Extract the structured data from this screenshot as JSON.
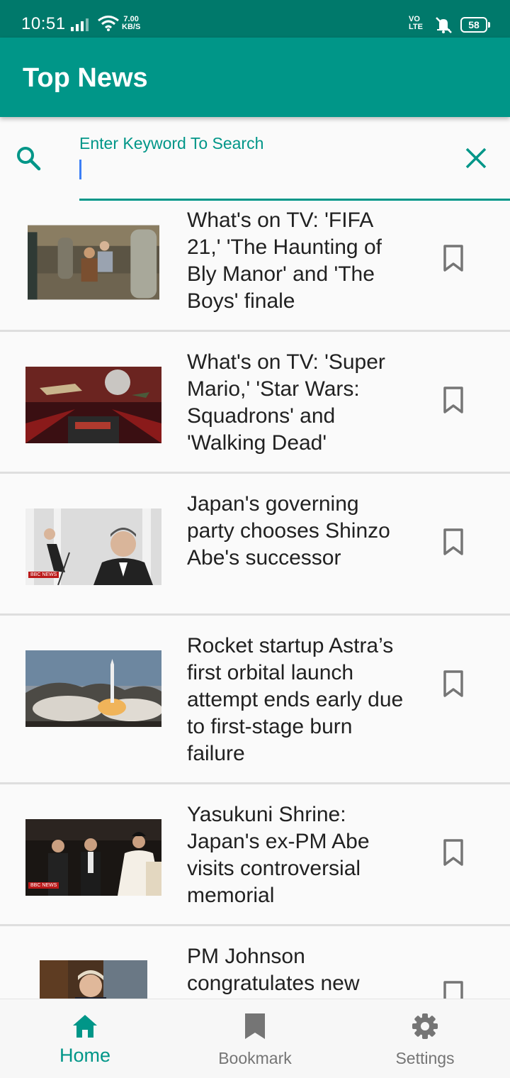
{
  "status_bar": {
    "time": "10:51",
    "net_speed_value": "7.00",
    "net_speed_unit": "KB/S",
    "volte_top": "VO",
    "volte_bottom": "LTE",
    "battery": "58"
  },
  "app_bar": {
    "title": "Top News"
  },
  "search": {
    "label": "Enter Keyword To Search",
    "value": ""
  },
  "news": [
    {
      "title": "What's on TV: 'FIFA 21,' 'The Haunting of Bly Manor' and 'The Boys' finale"
    },
    {
      "title": "What's on TV: 'Super Mario,' 'Star Wars: Squadrons' and 'Walking Dead'"
    },
    {
      "title": "Japan's governing party chooses Shinzo Abe's successor",
      "badge": "BBC NEWS"
    },
    {
      "title": "Rocket startup Astra’s first orbital launch attempt ends early due to first-stage burn failure"
    },
    {
      "title": "Yasukuni Shrine: Japan's ex-PM Abe visits controversial memorial",
      "badge": "BBC NEWS"
    },
    {
      "title": "PM Johnson congratulates new"
    }
  ],
  "bottom_nav": {
    "home": "Home",
    "bookmark": "Bookmark",
    "settings": "Settings"
  },
  "colors": {
    "status_bar": "#00796b",
    "primary": "#009688",
    "inactive": "#757575"
  }
}
